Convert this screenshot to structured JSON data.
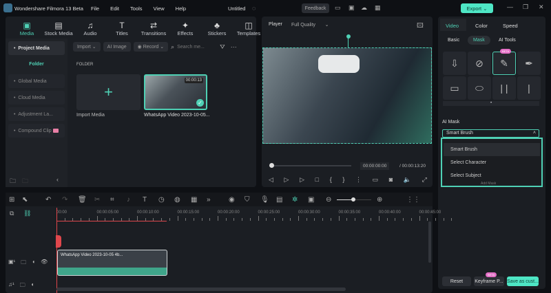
{
  "app": {
    "title": "Wondershare Filmora 13 Beta",
    "menu": [
      "File",
      "Edit",
      "Tools",
      "View",
      "Help"
    ],
    "project": "Untitled",
    "feedback": "Feedback",
    "export": "Export"
  },
  "media_tabs": [
    {
      "label": "Media",
      "icon": "▣",
      "active": true
    },
    {
      "label": "Stock Media",
      "icon": "▤"
    },
    {
      "label": "Audio",
      "icon": "♫"
    },
    {
      "label": "Titles",
      "icon": "T"
    },
    {
      "label": "Transitions",
      "icon": "⇄"
    },
    {
      "label": "Effects",
      "icon": "✦"
    },
    {
      "label": "Stickers",
      "icon": "♣"
    },
    {
      "label": "Templates",
      "icon": "◫"
    }
  ],
  "sidebar": {
    "project_media": "Project Media",
    "folder": "Folder",
    "items": [
      "Global Media",
      "Cloud Media",
      "Adjustment La...",
      "Compound Clip"
    ]
  },
  "toolbar": {
    "import": "Import",
    "ai_image": "AI Image",
    "record": "Record",
    "search_placeholder": "Search me..."
  },
  "library": {
    "folder_label": "FOLDER",
    "import_media": "Import Media",
    "clip_name": "WhatsApp Video 2023-10-05...",
    "clip_duration": "00:00:13"
  },
  "player": {
    "label": "Player",
    "quality": "Full Quality",
    "current_time": "00:00:00:00",
    "total_time": "/ 00:00:13:20",
    "progress": 0
  },
  "right_panel": {
    "tabs": [
      "Video",
      "Color",
      "Speed"
    ],
    "subtabs": [
      "Basic",
      "Mask",
      "AI Tools"
    ],
    "beta": "BETA",
    "ai_mask_label": "AI Mask",
    "ai_mask_value": "Smart Brush",
    "options": [
      "Smart Brush",
      "Select Character",
      "Select Subject"
    ],
    "hidden_text": "Add Mask",
    "reset": "Reset",
    "keyframe": "Keyframe P...",
    "save": "Save as cust..."
  },
  "timeline": {
    "ticks": [
      "00:00",
      "00:00:05:00",
      "00:00:10:00",
      "00:00:15:00",
      "00:00:20:00",
      "00:00:25:00",
      "00:00:30:00",
      "00:00:35:00",
      "00:00:40:00",
      "00:00:45:00"
    ],
    "clip_label": "WhatsApp Video 2023-10-05 4b...",
    "zoom_level": 0.5
  },
  "colors": {
    "accent": "#4fd1b5",
    "playhead": "#e0474c"
  }
}
